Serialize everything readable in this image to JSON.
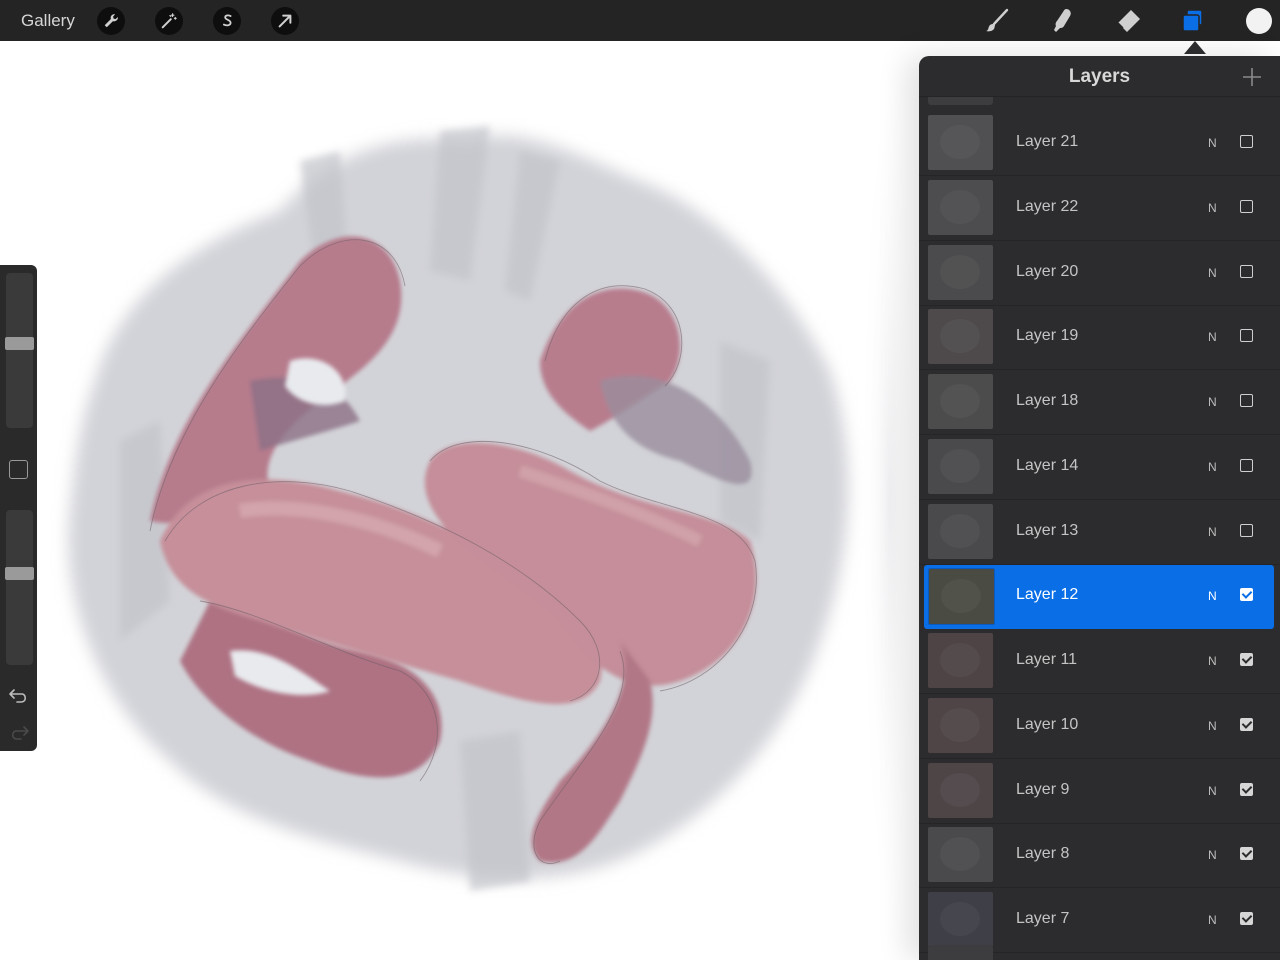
{
  "app": {
    "gallery_label": "Gallery"
  },
  "toolbar": {
    "left_tools": [
      "wrench-icon",
      "magic-wand-icon",
      "selection-s-icon",
      "transform-arrow-icon"
    ],
    "right_tools": [
      "brush-icon",
      "smudge-icon",
      "eraser-icon",
      "layers-icon"
    ],
    "active_tool": "layers-icon",
    "active_color": "#f2f2f2",
    "accent_color": "#0a6fe6"
  },
  "sidebar": {
    "brush_size": 0.45,
    "opacity": 0.4
  },
  "layers_panel": {
    "title": "Layers",
    "add_icon": "plus-icon",
    "layers": [
      {
        "name": "Layer 21",
        "mode": "N",
        "visible": false,
        "selected": false,
        "tint": "#505052"
      },
      {
        "name": "Layer 22",
        "mode": "N",
        "visible": false,
        "selected": false,
        "tint": "#4d4d4f"
      },
      {
        "name": "Layer 20",
        "mode": "N",
        "visible": false,
        "selected": false,
        "tint": "#4b4b4d"
      },
      {
        "name": "Layer 19",
        "mode": "N",
        "visible": false,
        "selected": false,
        "tint": "#4e4a4c"
      },
      {
        "name": "Layer 18",
        "mode": "N",
        "visible": false,
        "selected": false,
        "tint": "#4c4c4c"
      },
      {
        "name": "Layer 14",
        "mode": "N",
        "visible": false,
        "selected": false,
        "tint": "#4a4a4c"
      },
      {
        "name": "Layer 13",
        "mode": "N",
        "visible": false,
        "selected": false,
        "tint": "#4a4a4c"
      },
      {
        "name": "Layer 12",
        "mode": "N",
        "visible": true,
        "selected": true,
        "tint": "#4a4c44"
      },
      {
        "name": "Layer 11",
        "mode": "N",
        "visible": true,
        "selected": false,
        "tint": "#4e4446"
      },
      {
        "name": "Layer 10",
        "mode": "N",
        "visible": true,
        "selected": false,
        "tint": "#4f4547"
      },
      {
        "name": "Layer 9",
        "mode": "N",
        "visible": true,
        "selected": false,
        "tint": "#4e4547"
      },
      {
        "name": "Layer 8",
        "mode": "N",
        "visible": true,
        "selected": false,
        "tint": "#4a4a4c"
      },
      {
        "name": "Layer 7",
        "mode": "N",
        "visible": true,
        "selected": false,
        "tint": "#3f3f48"
      }
    ]
  }
}
